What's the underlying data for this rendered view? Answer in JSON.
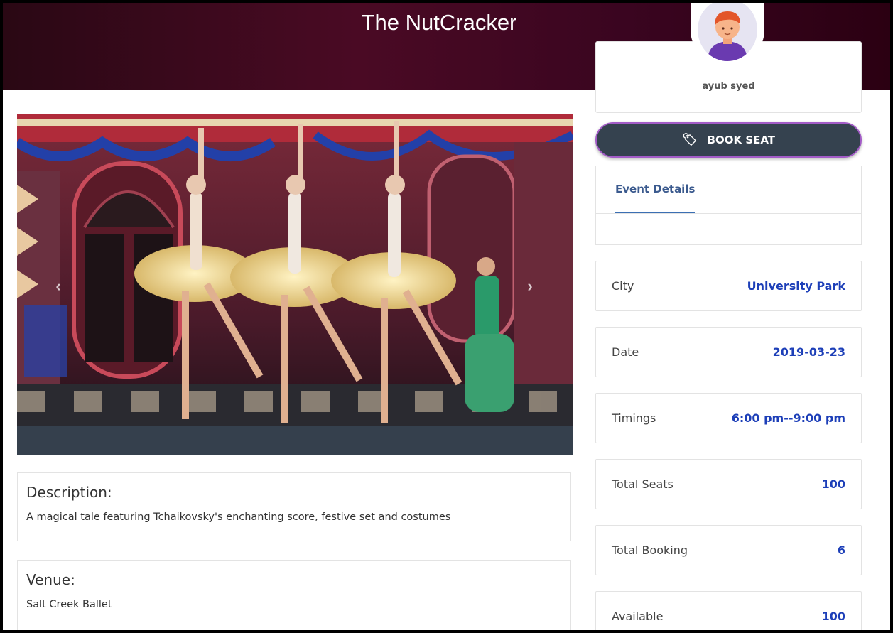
{
  "page": {
    "title": "The NutCracker"
  },
  "carousel": {
    "prev_glyph": "‹",
    "next_glyph": "›"
  },
  "description": {
    "heading": "Description:",
    "text": "A magical tale featuring Tchaikovsky's enchanting score, festive set and costumes"
  },
  "venue": {
    "heading": "Venue:",
    "text": "Salt Creek Ballet"
  },
  "profile": {
    "name": "ayub syed"
  },
  "book_button": {
    "label": "BOOK SEAT",
    "icon": "ticket-icon"
  },
  "tabs": [
    {
      "label": "Event Details",
      "active": true
    }
  ],
  "details": [
    {
      "label": "City",
      "value": "University Park"
    },
    {
      "label": "Date",
      "value": "2019-03-23"
    },
    {
      "label": "Timings",
      "value": "6:00 pm--9:00 pm"
    },
    {
      "label": "Total Seats",
      "value": "100"
    },
    {
      "label": "Total Booking",
      "value": "6"
    },
    {
      "label": "Available",
      "value": "100"
    }
  ],
  "colors": {
    "header_bg": "#3a0520",
    "button_bg": "#35424f",
    "button_border": "#a35cc7",
    "value_text": "#1d3fb8",
    "tab_active": "#3b5a8e"
  }
}
